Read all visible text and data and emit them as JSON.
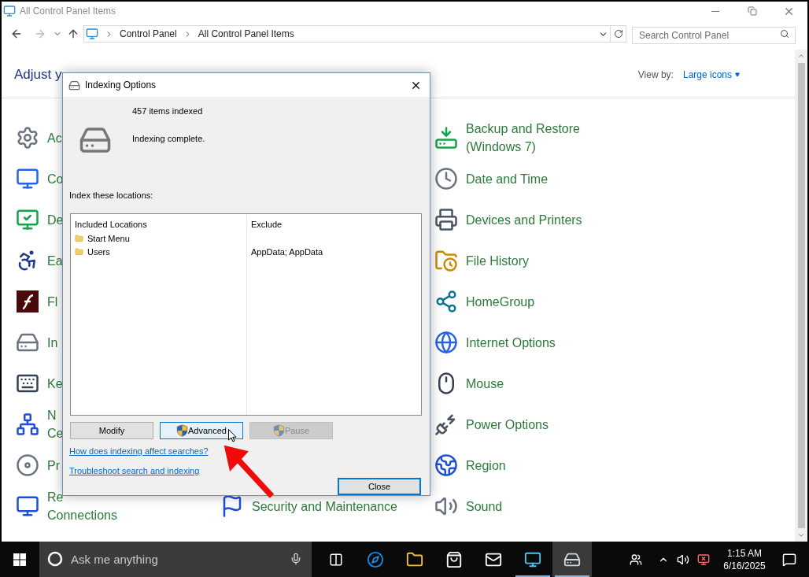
{
  "window": {
    "title": "All Control Panel Items"
  },
  "address_bar": {
    "breadcrumbs": [
      "Control Panel",
      "All Control Panel Items"
    ]
  },
  "search": {
    "placeholder": "Search Control Panel"
  },
  "page": {
    "heading": "Adjust y",
    "view_by_label": "View by:",
    "view_by_value": "Large icons"
  },
  "left_column": [
    {
      "lines": [
        "Ac"
      ]
    },
    {
      "lines": [
        "Co"
      ]
    },
    {
      "lines": [
        "De"
      ]
    },
    {
      "lines": [
        "Ea"
      ]
    },
    {
      "lines": [
        "Fl"
      ]
    },
    {
      "lines": [
        "In"
      ]
    },
    {
      "lines": [
        "Ke"
      ]
    },
    {
      "lines": [
        "N",
        "Ce"
      ]
    },
    {
      "lines": [
        "Pr"
      ]
    },
    {
      "lines": [
        "Re",
        "Connections"
      ]
    }
  ],
  "middle_column": [
    {
      "lines": [
        "Security and Maintenance"
      ]
    }
  ],
  "right_column": [
    {
      "lines": [
        "Backup and Restore",
        "(Windows 7)"
      ]
    },
    {
      "lines": [
        "Date and Time"
      ]
    },
    {
      "lines": [
        "Devices and Printers"
      ]
    },
    {
      "lines": [
        "File History"
      ]
    },
    {
      "lines": [
        "HomeGroup"
      ]
    },
    {
      "lines": [
        "Internet Options"
      ]
    },
    {
      "lines": [
        "Mouse"
      ]
    },
    {
      "lines": [
        "Power Options"
      ]
    },
    {
      "lines": [
        "Region"
      ]
    },
    {
      "lines": [
        "Sound"
      ]
    }
  ],
  "dialog": {
    "title": "Indexing Options",
    "items_count": "457 items indexed",
    "status": "Indexing complete.",
    "locations_label": "Index these locations:",
    "columns": [
      "Included Locations",
      "Exclude"
    ],
    "locations": [
      {
        "included": "Start Menu"
      },
      {
        "included": "Users",
        "exclude": "AppData; AppData"
      }
    ],
    "buttons": [
      {
        "label": "Modify",
        "shield": false,
        "hovered": false,
        "disabled": false
      },
      {
        "label": "Advanced",
        "shield": true,
        "hovered": true,
        "disabled": false
      },
      {
        "label": "Pause",
        "shield": true,
        "hovered": false,
        "disabled": true
      }
    ],
    "links": [
      "How does indexing affect searches?",
      "Troubleshoot search and indexing"
    ],
    "close_button": {
      "label": "Close",
      "default": true
    }
  },
  "taskbar": {
    "search_placeholder": "Ask me anything",
    "apps": [
      {
        "open": false,
        "selected": false
      },
      {
        "open": false,
        "selected": false
      },
      {
        "open": false,
        "selected": false
      },
      {
        "open": false,
        "selected": false
      },
      {
        "open": true,
        "selected": false
      },
      {
        "open": true,
        "selected": true
      }
    ],
    "clock": {
      "time": "1:15 AM",
      "date": "6/16/2025"
    }
  }
}
